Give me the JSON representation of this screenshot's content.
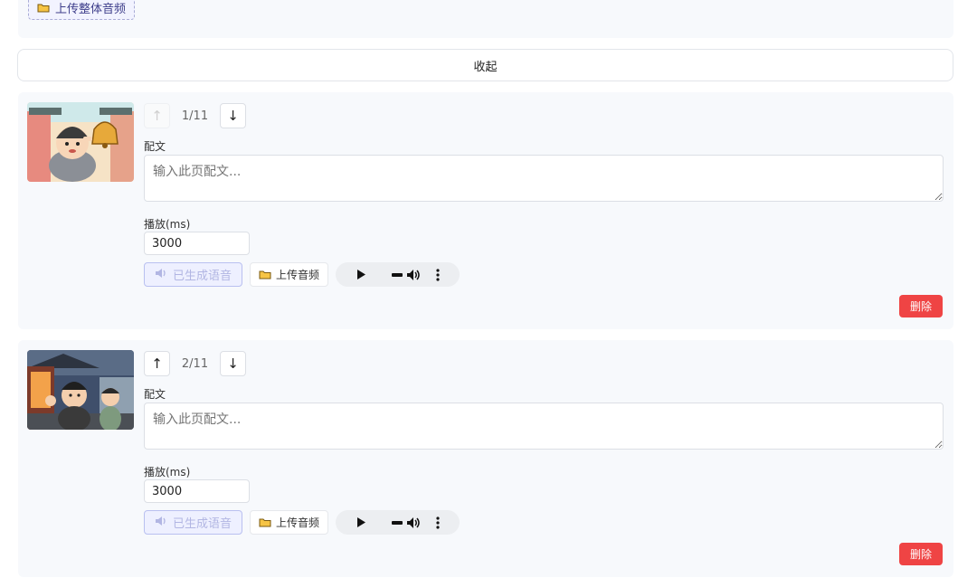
{
  "top": {
    "upload_all_label": "上传整体音频",
    "collapse_label": "收起"
  },
  "cards": [
    {
      "page": "1/11",
      "text_label": "配文",
      "text_placeholder": "输入此页配文...",
      "ms_label": "播放(ms)",
      "ms_value": "3000",
      "generated_label": "已生成语音",
      "upload_label": "上传音频",
      "delete_label": "删除",
      "up_arrow": "↑",
      "down_arrow": "↓",
      "up_disabled": true
    },
    {
      "page": "2/11",
      "text_label": "配文",
      "text_placeholder": "输入此页配文...",
      "ms_label": "播放(ms)",
      "ms_value": "3000",
      "generated_label": "已生成语音",
      "upload_label": "上传音频",
      "delete_label": "删除",
      "up_arrow": "↑",
      "down_arrow": "↓",
      "up_disabled": false
    }
  ],
  "colors": {
    "accent": "#ef4444",
    "card_bg": "#f7f9fc",
    "generated_text": "#b2b6e3"
  },
  "icons": [
    "folder-icon",
    "speaker-icon",
    "play-icon",
    "volume-icon",
    "more-vertical-icon",
    "arrow-up-icon",
    "arrow-down-icon"
  ]
}
